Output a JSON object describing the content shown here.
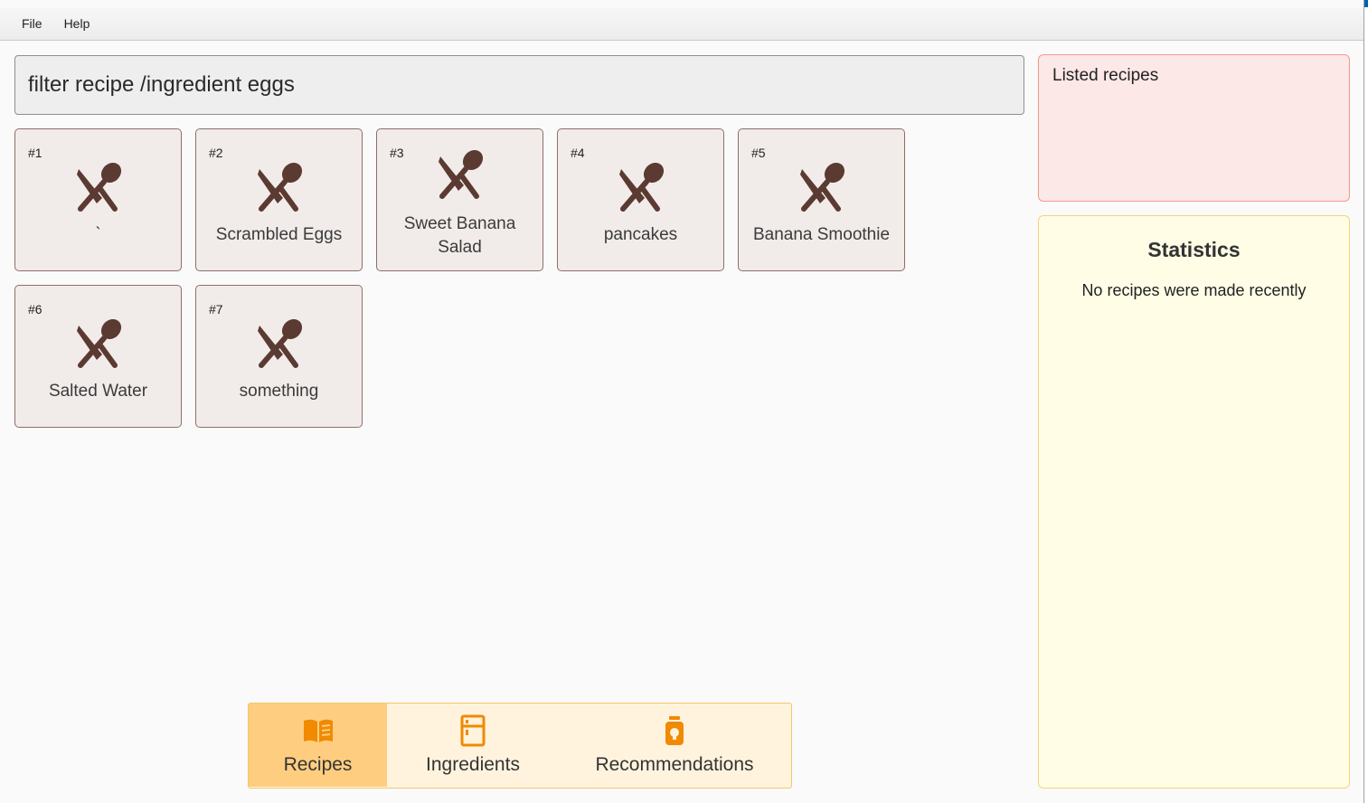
{
  "menubar": {
    "items": [
      "File",
      "Help"
    ]
  },
  "command": {
    "value": "filter recipe /ingredient eggs"
  },
  "recipes": [
    {
      "index": "#1",
      "name": "`"
    },
    {
      "index": "#2",
      "name": "Scrambled Eggs"
    },
    {
      "index": "#3",
      "name": "Sweet Banana Salad"
    },
    {
      "index": "#4",
      "name": "pancakes"
    },
    {
      "index": "#5",
      "name": "Banana Smoothie"
    },
    {
      "index": "#6",
      "name": "Salted Water"
    },
    {
      "index": "#7",
      "name": "something"
    }
  ],
  "listed_panel": {
    "label": "Listed recipes"
  },
  "statistics": {
    "title": "Statistics",
    "empty_message": "No recipes were made recently"
  },
  "tabs": [
    {
      "label": "Recipes",
      "icon": "book-icon",
      "active": true
    },
    {
      "label": "Ingredients",
      "icon": "fridge-icon",
      "active": false
    },
    {
      "label": "Recommendations",
      "icon": "jar-icon",
      "active": false
    }
  ],
  "colors": {
    "accent_blue": "#0063b1",
    "card_bg": "#f1ecea",
    "card_border": "#8d6f67",
    "utensil_icon": "#5b3a32",
    "listed_bg": "#fce8e6",
    "stats_bg": "#fffde6",
    "tab_active": "#ffcd80",
    "tab_icon": "#f08a00"
  }
}
